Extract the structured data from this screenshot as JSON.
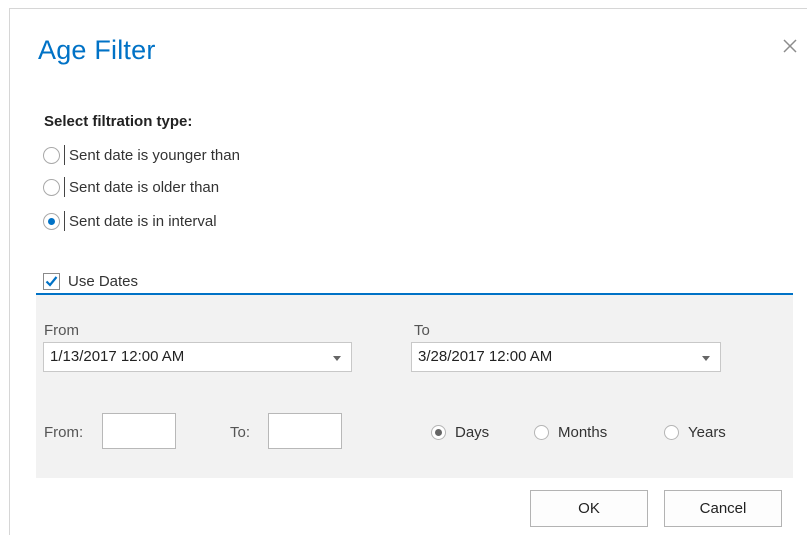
{
  "dialog": {
    "title": "Age Filter",
    "close_label": "×"
  },
  "filtration": {
    "heading": "Select filtration type:",
    "options": [
      {
        "label": "Sent date is younger than",
        "checked": false
      },
      {
        "label": "Sent date is older than",
        "checked": false
      },
      {
        "label": "Sent date is in interval",
        "checked": true
      }
    ]
  },
  "use_dates": {
    "label": "Use Dates",
    "checked": true
  },
  "dates": {
    "from_label": "From",
    "from_value": "1/13/2017 12:00 AM",
    "to_label": "To",
    "to_value": "3/28/2017 12:00 AM"
  },
  "relative": {
    "from_label": "From:",
    "from_value": "",
    "to_label": "To:",
    "to_value": "",
    "units": [
      {
        "label": "Days",
        "checked": true
      },
      {
        "label": "Months",
        "checked": false
      },
      {
        "label": "Years",
        "checked": false
      }
    ]
  },
  "buttons": {
    "ok": "OK",
    "cancel": "Cancel"
  },
  "colors": {
    "accent": "#0072c6",
    "panel": "#f2f2f2"
  }
}
